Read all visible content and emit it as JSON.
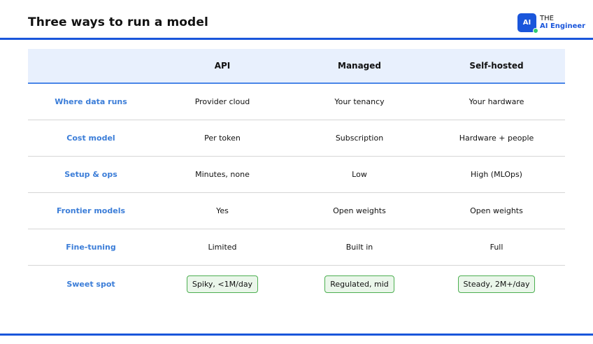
{
  "header": {
    "title": "Three ways to run a model",
    "brand": {
      "logo_text": "AI",
      "top": "THE",
      "bottom": "AI Engineer"
    }
  },
  "colors": {
    "accent": "#1a56db",
    "label": "#3b7dd8",
    "chip_border": "#4caf50",
    "chip_bg": "#eaf6ea",
    "header_bg": "#e8f0fd"
  },
  "table": {
    "columns": [
      "",
      "API",
      "Managed",
      "Self-hosted"
    ],
    "rows": [
      {
        "label": "Where data runs",
        "cells": [
          "Provider cloud",
          "Your tenancy",
          "Your hardware"
        ]
      },
      {
        "label": "Cost model",
        "cells": [
          "Per token",
          "Subscription",
          "Hardware + people"
        ]
      },
      {
        "label": "Setup & ops",
        "cells": [
          "Minutes, none",
          "Low",
          "High (MLOps)"
        ]
      },
      {
        "label": "Frontier models",
        "cells": [
          "Yes",
          "Open weights",
          "Open weights"
        ]
      },
      {
        "label": "Fine-tuning",
        "cells": [
          "Limited",
          "Built in",
          "Full"
        ]
      },
      {
        "label": "Sweet spot",
        "cells": [
          "Spiky, <1M/day",
          "Regulated, mid",
          "Steady, 2M+/day"
        ]
      }
    ]
  }
}
